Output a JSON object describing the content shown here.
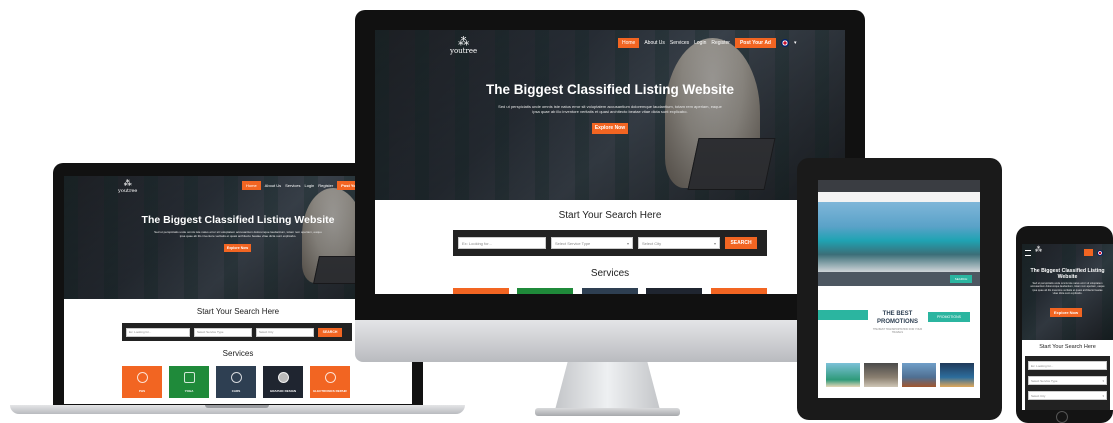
{
  "hero": {
    "logo_mark": "⁂",
    "logo_text": "youtree",
    "title": "The Biggest Classified Listing Website",
    "subtitle": "Sed ut perspiciatis unde omnis iste natus error sit voluptatem accusantium doloremque laudantium, totam rem aperiam, eaque ipsa quae ab illo inventore veritatis et quasi architecto beatae vitae dicta sunt explicabo.",
    "explore_label": "Explore Now"
  },
  "nav": {
    "home": "Home",
    "about": "About Us",
    "services": "Services",
    "login": "Login",
    "register": "Register",
    "post_ad": "Post Your Ad",
    "caret": "▾"
  },
  "search": {
    "heading": "Start Your Search Here",
    "keyword_placeholder": "Ex: Looking for...",
    "service_placeholder": "Select Service Type",
    "city_placeholder": "Select City",
    "button": "SEARCH"
  },
  "services": {
    "heading": "Services",
    "items": [
      {
        "label": "PHS",
        "color": "#f26522"
      },
      {
        "label": "YOGA",
        "color": "#1f8a3a"
      },
      {
        "label": "CARS",
        "color": "#2e3f52"
      },
      {
        "label": "GRAPHIC DESIGN",
        "color": "#1f2530"
      },
      {
        "label": "ELECTRONICS REPAIR",
        "color": "#f26522"
      }
    ]
  },
  "tablet": {
    "promo_title": "THE BEST PROMOTIONS",
    "promo_sub": "THE BEST TRANSPORTATION FOR YOUR TRAVELS",
    "promotions_btn": "PROMOTIONS",
    "search_btn": "SEARCH"
  },
  "colors": {
    "accent": "#f26522",
    "teal": "#2bb5a0",
    "dark": "#222222"
  }
}
